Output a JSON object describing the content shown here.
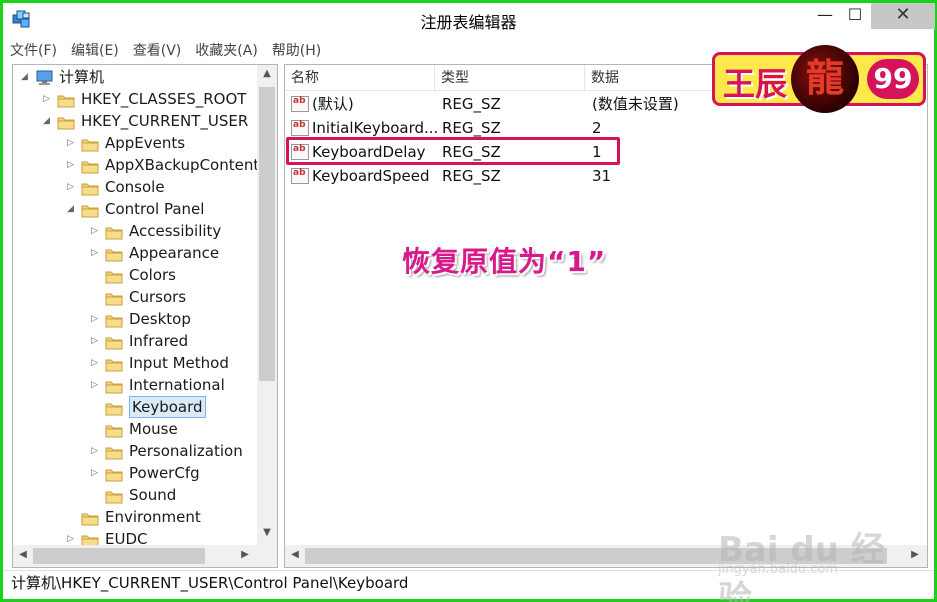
{
  "window": {
    "title": "注册表编辑器",
    "minimize_glyph": "—",
    "maximize_glyph": "☐",
    "close_glyph": "✕"
  },
  "menu": [
    {
      "label": "文件(F)"
    },
    {
      "label": "编辑(E)"
    },
    {
      "label": "查看(V)"
    },
    {
      "label": "收藏夹(A)"
    },
    {
      "label": "帮助(H)"
    }
  ],
  "tree": {
    "nodes": [
      {
        "label": "计算机",
        "expander": "◢",
        "icon": "computer-icon"
      },
      {
        "label": "HKEY_CLASSES_ROOT",
        "expander": "▷",
        "icon": "folder-icon"
      },
      {
        "label": "HKEY_CURRENT_USER",
        "expander": "◢",
        "icon": "folder-icon"
      },
      {
        "label": "AppEvents",
        "expander": "▷",
        "icon": "folder-icon"
      },
      {
        "label": "AppXBackupContent",
        "expander": "▷",
        "icon": "folder-icon"
      },
      {
        "label": "Console",
        "expander": "▷",
        "icon": "folder-icon"
      },
      {
        "label": "Control Panel",
        "expander": "◢",
        "icon": "folder-icon"
      },
      {
        "label": "Accessibility",
        "expander": "▷",
        "icon": "folder-icon"
      },
      {
        "label": "Appearance",
        "expander": "▷",
        "icon": "folder-icon"
      },
      {
        "label": "Colors",
        "expander": "",
        "icon": "folder-icon"
      },
      {
        "label": "Cursors",
        "expander": "",
        "icon": "folder-icon"
      },
      {
        "label": "Desktop",
        "expander": "▷",
        "icon": "folder-icon"
      },
      {
        "label": "Infrared",
        "expander": "▷",
        "icon": "folder-icon"
      },
      {
        "label": "Input Method",
        "expander": "▷",
        "icon": "folder-icon"
      },
      {
        "label": "International",
        "expander": "▷",
        "icon": "folder-icon"
      },
      {
        "label": "Keyboard",
        "expander": "",
        "icon": "folder-icon",
        "selected": true
      },
      {
        "label": "Mouse",
        "expander": "",
        "icon": "folder-icon"
      },
      {
        "label": "Personalization",
        "expander": "▷",
        "icon": "folder-icon"
      },
      {
        "label": "PowerCfg",
        "expander": "▷",
        "icon": "folder-icon"
      },
      {
        "label": "Sound",
        "expander": "",
        "icon": "folder-icon"
      },
      {
        "label": "Environment",
        "expander": "",
        "icon": "folder-icon"
      },
      {
        "label": "EUDC",
        "expander": "▷",
        "icon": "folder-icon"
      }
    ]
  },
  "list": {
    "columns": [
      "名称",
      "类型",
      "数据"
    ],
    "rows": [
      {
        "name": "(默认)",
        "type": "REG_SZ",
        "data": "(数值未设置)"
      },
      {
        "name": "InitialKeyboard...",
        "type": "REG_SZ",
        "data": "2"
      },
      {
        "name": "KeyboardDelay",
        "type": "REG_SZ",
        "data": "1",
        "highlighted": true
      },
      {
        "name": "KeyboardSpeed",
        "type": "REG_SZ",
        "data": "31"
      }
    ],
    "value_icon_text": "ab"
  },
  "status_bar": {
    "path": "计算机\\HKEY_CURRENT_USER\\Control Panel\\Keyboard"
  },
  "annotation": {
    "text": "恢复原值为“1”",
    "color": "#d8198a"
  },
  "badge": {
    "name": "王辰",
    "dragon_char": "龍",
    "number": "99",
    "background": "#ffe94a",
    "border": "#d6135a"
  },
  "watermark": {
    "main": "Bai du 经验",
    "sub": "jingyan.baidu.com"
  },
  "scroll_arrows": {
    "up": "▲",
    "down": "▼",
    "left": "◀",
    "right": "▶"
  },
  "colors": {
    "frame": "#19d219",
    "selection": "#dbeaf7",
    "highlight_box": "#d6135a"
  }
}
